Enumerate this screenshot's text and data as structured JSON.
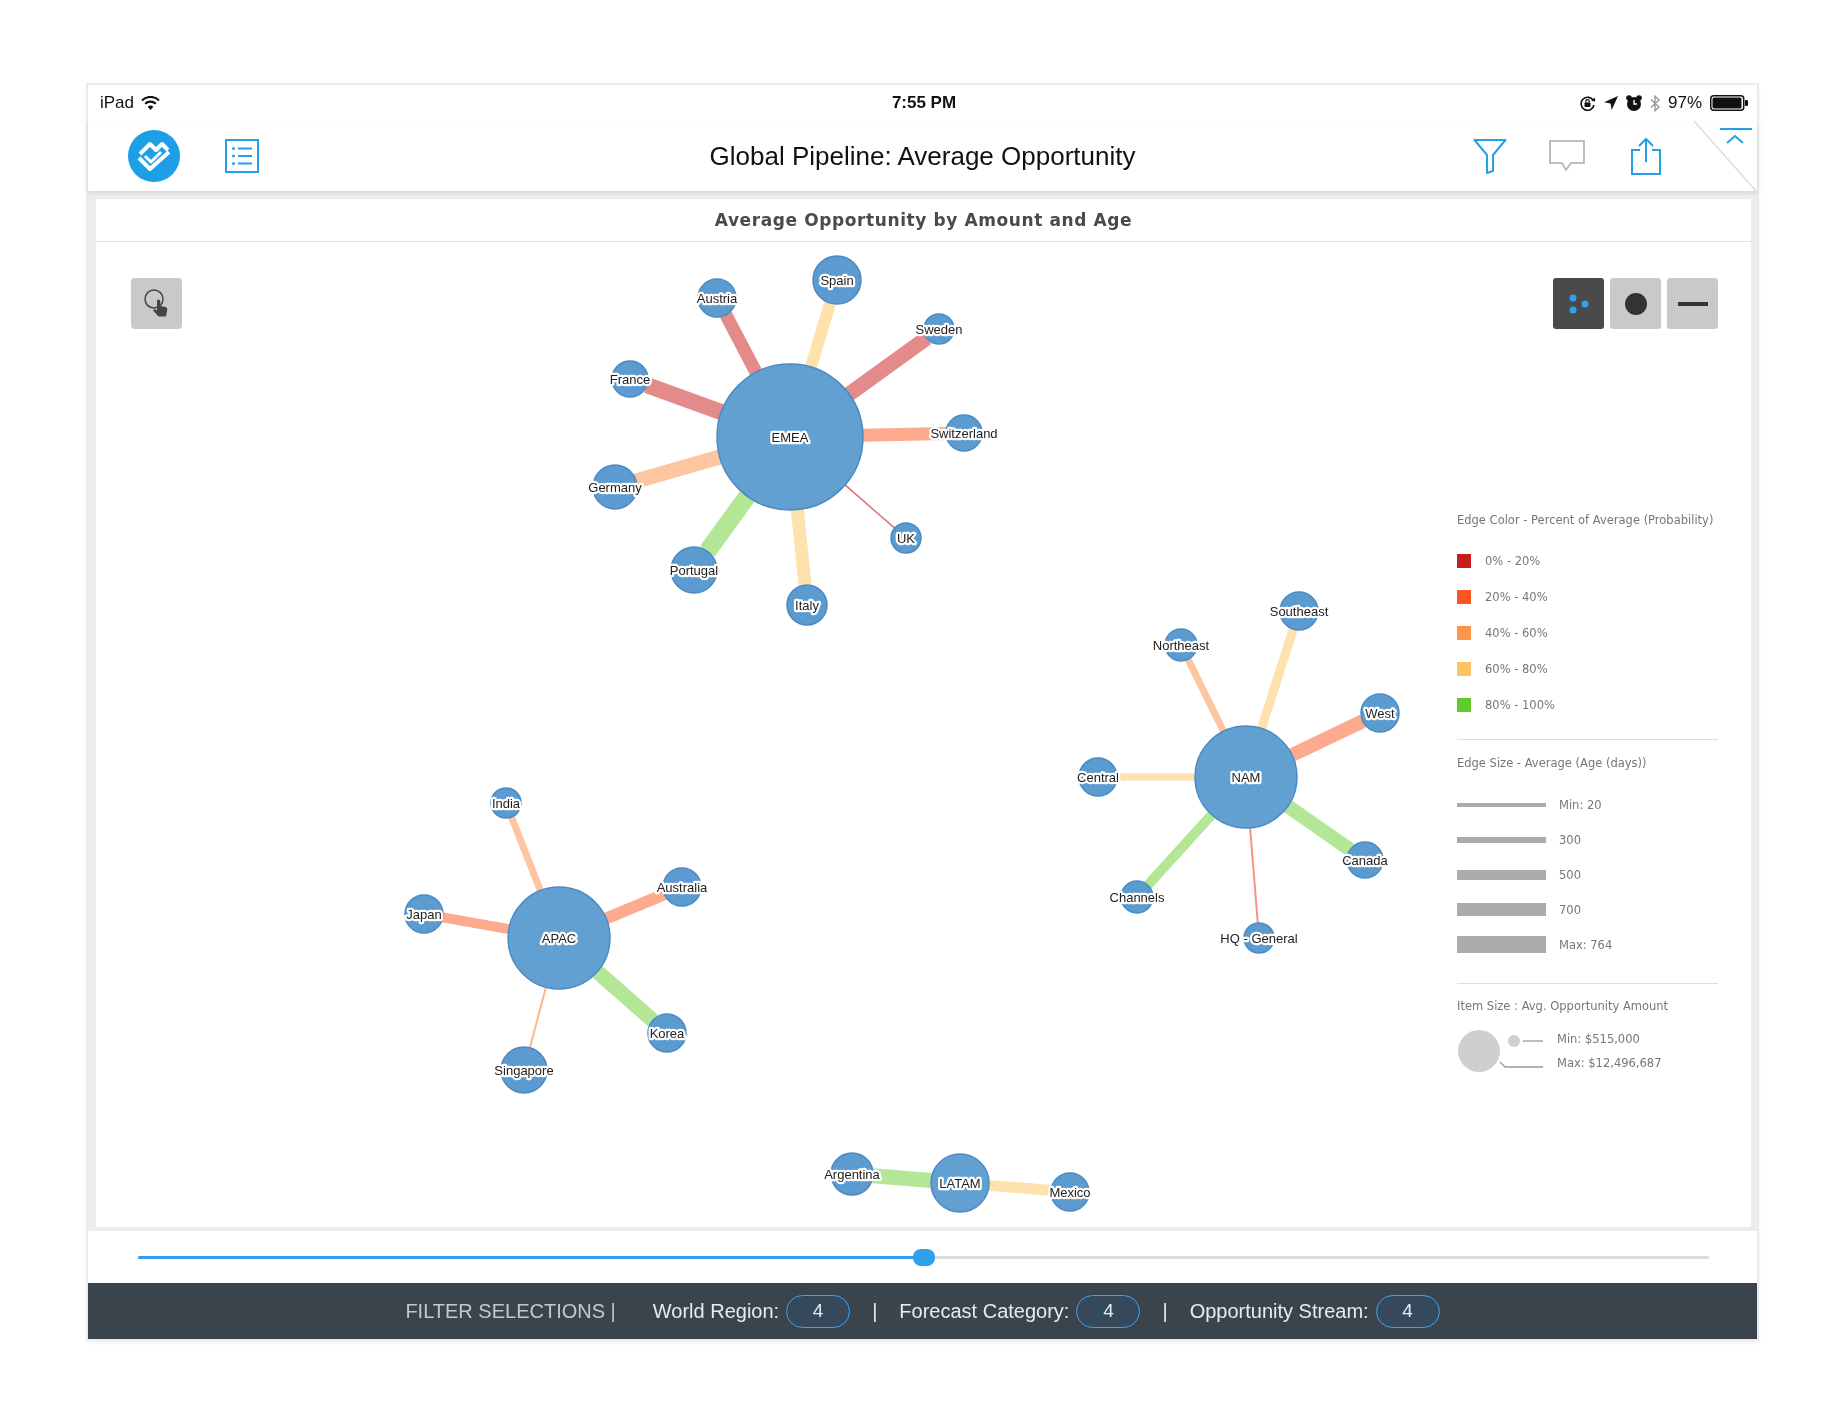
{
  "status_bar": {
    "device": "iPad",
    "time": "7:55 PM",
    "battery": "97%"
  },
  "header": {
    "title": "Global Pipeline: Average Opportunity"
  },
  "chart": {
    "title": "Average Opportunity by Amount and Age",
    "view_modes": [
      {
        "kind": "dots",
        "selected": true
      },
      {
        "kind": "circle",
        "selected": false
      },
      {
        "kind": "dash",
        "selected": false
      }
    ],
    "clusters": [
      {
        "hub": "EMEA",
        "nodes": [
          {
            "label": "Spain",
            "color": "#fde2ad"
          },
          {
            "label": "Austria",
            "color": "#e38a8a"
          },
          {
            "label": "Sweden",
            "color": "#e38a8a"
          },
          {
            "label": "France",
            "color": "#e38a8a"
          },
          {
            "label": "Switzerland",
            "color": "#fdaa8e"
          },
          {
            "label": "Germany",
            "color": "#fdc6a0"
          },
          {
            "label": "UK",
            "color": "#e07373"
          },
          {
            "label": "Portugal",
            "color": "#b3e695"
          },
          {
            "label": "Italy",
            "color": "#fde2ad"
          }
        ]
      },
      {
        "hub": "NAM",
        "nodes": [
          {
            "label": "Southeast",
            "color": "#fde2ad"
          },
          {
            "label": "Northeast",
            "color": "#fdc6a0"
          },
          {
            "label": "West",
            "color": "#fdaa8e"
          },
          {
            "label": "Central",
            "color": "#fde2ad"
          },
          {
            "label": "Canada",
            "color": "#b3e695"
          },
          {
            "label": "Channels",
            "color": "#b3e695"
          },
          {
            "label": "HQ - General",
            "color": "#f7957c"
          }
        ]
      },
      {
        "hub": "APAC",
        "nodes": [
          {
            "label": "India",
            "color": "#fdc6a0"
          },
          {
            "label": "Australia",
            "color": "#fdaa8e"
          },
          {
            "label": "Japan",
            "color": "#fdaa8e"
          },
          {
            "label": "Korea",
            "color": "#b3e695"
          },
          {
            "label": "Singapore",
            "color": "#fbb88f"
          }
        ]
      },
      {
        "hub": "LATAM",
        "nodes": [
          {
            "label": "Argentina",
            "color": "#b3e695"
          },
          {
            "label": "Mexico",
            "color": "#fde2ad"
          }
        ]
      }
    ],
    "legend": {
      "edge_color": {
        "title": "Edge Color - Percent of Average (Probability)",
        "items": [
          {
            "label": "0% - 20%",
            "color": "#c91e1e"
          },
          {
            "label": "20% - 40%",
            "color": "#fd5424"
          },
          {
            "label": "40% - 60%",
            "color": "#fd9448"
          },
          {
            "label": "60% - 80%",
            "color": "#fec25e"
          },
          {
            "label": "80% - 100%",
            "color": "#60cc2c"
          }
        ]
      },
      "edge_size": {
        "title": "Edge Size - Average (Age (days))",
        "items": [
          "Min: 20",
          "300",
          "500",
          "700",
          "Max: 764"
        ]
      },
      "item_size": {
        "title": "Item Size : Avg. Opportunity Amount",
        "min": "Min: $515,000",
        "max": "Max: $12,496,687"
      }
    }
  },
  "slider": {
    "level": 0.5
  },
  "filter_bar": {
    "title": "FILTER SELECTIONS |",
    "items": [
      {
        "kind": "filter",
        "label": "World Region:",
        "count": "4"
      },
      {
        "kind": "separator",
        "text": "|"
      },
      {
        "kind": "filter",
        "label": "Forecast Category:",
        "count": "4"
      },
      {
        "kind": "separator",
        "text": "|"
      },
      {
        "kind": "filter",
        "label": "Opportunity Stream:",
        "count": "4"
      }
    ]
  }
}
